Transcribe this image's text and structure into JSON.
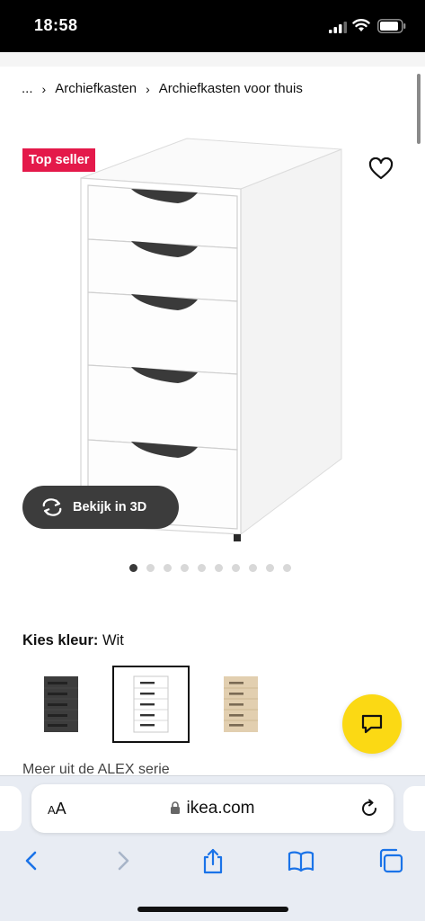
{
  "status_bar": {
    "time": "18:58"
  },
  "breadcrumb": {
    "ellipsis": "...",
    "items": [
      "Archiefkasten",
      "Archiefkasten voor thuis"
    ]
  },
  "product": {
    "badge": "Top seller",
    "view_3d_label": "Bekijk in 3D",
    "image_count": 10,
    "active_image_index": 0
  },
  "color_picker": {
    "label": "Kies kleur:",
    "selected_value": "Wit",
    "options": [
      "dark grey",
      "white",
      "oak"
    ],
    "selected_index": 1
  },
  "series_link": "Meer uit de ALEX serie",
  "browser": {
    "text_size_label_small": "A",
    "text_size_label_large": "A",
    "url": "ikea.com"
  },
  "colors": {
    "badge": "#e4194a",
    "chat_button": "#fbd914",
    "safari_blue": "#1a73e8",
    "toolbar_bg": "#e8ecf3"
  },
  "icons": {
    "heart": "heart-icon",
    "rotate": "rotate-3d-icon",
    "chat": "chat-icon",
    "lock": "lock-icon",
    "reload": "reload-icon",
    "back": "back-arrow-icon",
    "forward": "forward-arrow-icon",
    "share": "share-icon",
    "bookmarks": "bookmarks-icon",
    "tabs": "tabs-icon"
  }
}
